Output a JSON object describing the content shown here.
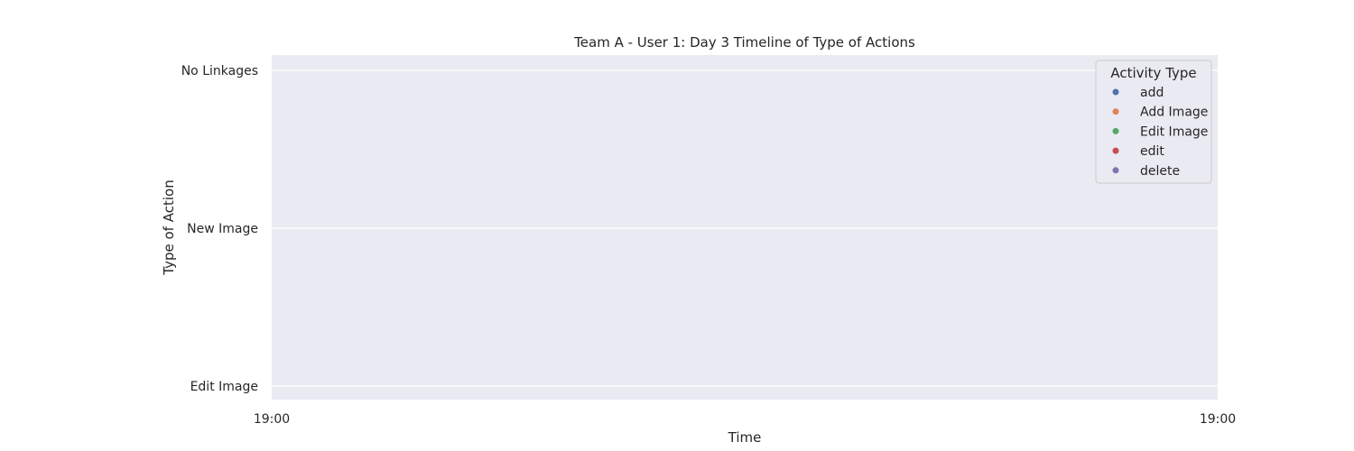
{
  "chart_data": {
    "type": "scatter",
    "title": "Team A - User 1: Day 3 Timeline of Type of Actions",
    "xlabel": "Time",
    "ylabel": "Type of Action",
    "x_ticks": [
      "19:00",
      "19:00"
    ],
    "y_categories": [
      "No Linkages",
      "New Image",
      "Edit Image"
    ],
    "grid": true,
    "legend": {
      "title": "Activity Type",
      "placement": "top-right",
      "entries": [
        {
          "name": "add",
          "color": "#4c72b0"
        },
        {
          "name": "Add Image",
          "color": "#dd8452"
        },
        {
          "name": "Edit Image",
          "color": "#55a868"
        },
        {
          "name": "edit",
          "color": "#c44e52"
        },
        {
          "name": "delete",
          "color": "#8172b3"
        }
      ]
    },
    "series": []
  },
  "colors": {
    "plot_background": "#eaeaf2",
    "grid": "#ffffff",
    "text": "#262626"
  }
}
